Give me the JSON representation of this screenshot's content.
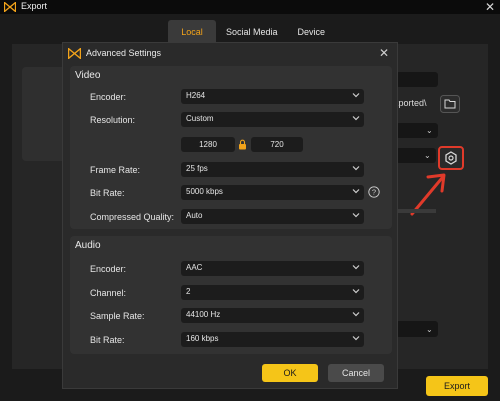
{
  "window": {
    "title": "Export"
  },
  "tabs": [
    {
      "label": "Local"
    },
    {
      "label": "Social Media"
    },
    {
      "label": "Device"
    }
  ],
  "outer": {
    "path_text": "xported\\",
    "export_label": "Export"
  },
  "dialog": {
    "title": "Advanced Settings",
    "video": {
      "section_title": "Video",
      "encoder": {
        "label": "Encoder:",
        "value": "H264"
      },
      "resolution": {
        "label": "Resolution:",
        "value": "Custom",
        "width": "1280",
        "height": "720"
      },
      "frame_rate": {
        "label": "Frame Rate:",
        "value": "25 fps"
      },
      "bit_rate": {
        "label": "Bit Rate:",
        "value": "5000 kbps"
      },
      "compressed_quality": {
        "label": "Compressed Quality:",
        "value": "Auto"
      }
    },
    "audio": {
      "section_title": "Audio",
      "encoder": {
        "label": "Encoder:",
        "value": "AAC"
      },
      "channel": {
        "label": "Channel:",
        "value": "2"
      },
      "sample_rate": {
        "label": "Sample Rate:",
        "value": "44100 Hz"
      },
      "bit_rate": {
        "label": "Bit Rate:",
        "value": "160 kbps"
      }
    },
    "ok_label": "OK",
    "cancel_label": "Cancel"
  },
  "colors": {
    "accent": "#f5c518",
    "tab_active": "#f2a31a",
    "annotation": "#e03a2a"
  },
  "icons": [
    "logo-icon",
    "close-icon",
    "lock-icon",
    "help-icon",
    "chevron-down-icon",
    "folder-icon",
    "gear-icon"
  ]
}
